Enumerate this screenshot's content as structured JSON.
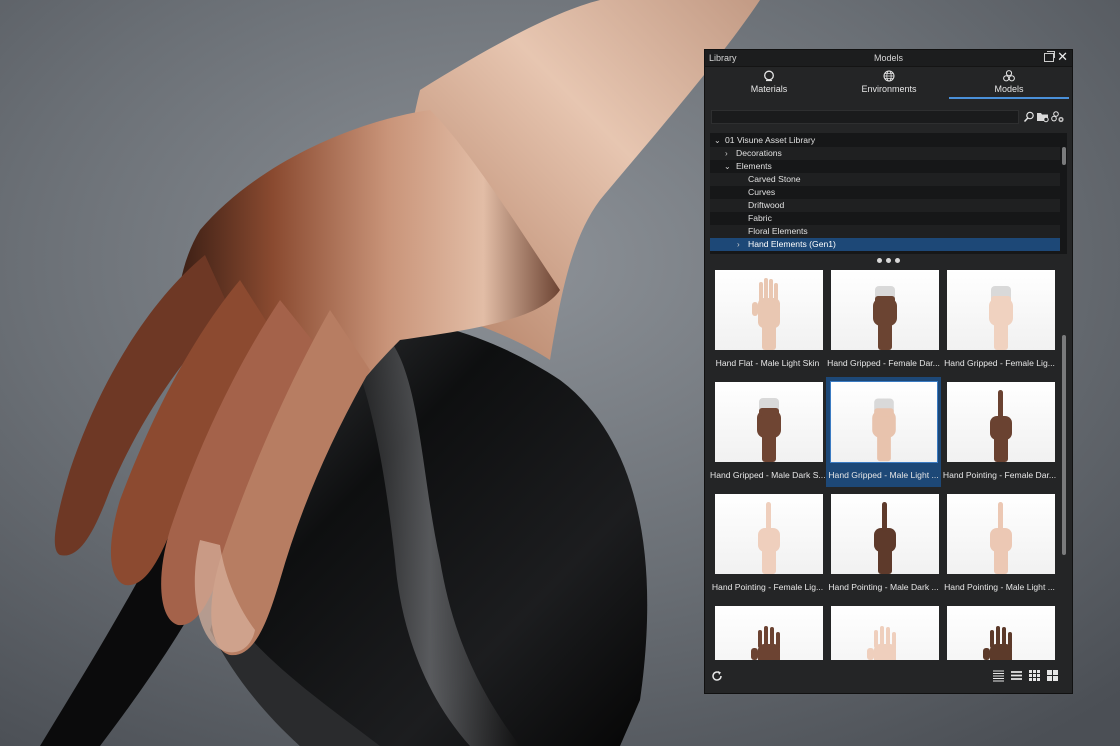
{
  "panel": {
    "window_title": "Library",
    "header_title": "Models"
  },
  "tabs": [
    {
      "label": "Materials",
      "icon": "materials-icon"
    },
    {
      "label": "Environments",
      "icon": "globe-icon"
    },
    {
      "label": "Models",
      "icon": "models-icon",
      "active": true
    }
  ],
  "search": {
    "value": "",
    "placeholder": ""
  },
  "tree": [
    {
      "label": "01 Visune Asset Library",
      "level": 0,
      "expanded": true
    },
    {
      "label": "Decorations",
      "level": 1,
      "expanded": false
    },
    {
      "label": "Elements",
      "level": 1,
      "expanded": true
    },
    {
      "label": "Carved Stone",
      "level": 2
    },
    {
      "label": "Curves",
      "level": 2
    },
    {
      "label": "Driftwood",
      "level": 2
    },
    {
      "label": "Fabric",
      "level": 2
    },
    {
      "label": "Floral Elements",
      "level": 2
    },
    {
      "label": "Hand Elements (Gen1)",
      "level": 2,
      "expanded": false,
      "selected": true
    }
  ],
  "items": [
    {
      "caption": "Hand Flat - Male Light Skin",
      "skin": "#e9c7b2",
      "pose": "flat"
    },
    {
      "caption": "Hand Gripped - Female Dar...",
      "skin": "#6b4432",
      "pose": "grip"
    },
    {
      "caption": "Hand Gripped - Female Lig...",
      "skin": "#f0d2c0",
      "pose": "grip"
    },
    {
      "caption": "Hand Gripped - Male Dark S...",
      "skin": "#6f4533",
      "pose": "grip"
    },
    {
      "caption": "Hand Gripped - Male Light ...",
      "skin": "#e8c3ad",
      "pose": "grip",
      "selected": true
    },
    {
      "caption": "Hand Pointing - Female Dar...",
      "skin": "#6a4231",
      "pose": "point"
    },
    {
      "caption": "Hand Pointing - Female Lig...",
      "skin": "#efcfbd",
      "pose": "point"
    },
    {
      "caption": "Hand Pointing - Male Dark ...",
      "skin": "#5e3a2b",
      "pose": "point"
    },
    {
      "caption": "Hand Pointing - Male Light ...",
      "skin": "#ecc8b4",
      "pose": "point"
    },
    {
      "caption": "",
      "skin": "#6c4332",
      "pose": "open"
    },
    {
      "caption": "",
      "skin": "#efcfbd",
      "pose": "open"
    },
    {
      "caption": "",
      "skin": "#5c3a2a",
      "pose": "open"
    }
  ],
  "colors": {
    "panel_bg": "#242526",
    "selection": "#1d4877",
    "accent": "#4a90d9"
  }
}
